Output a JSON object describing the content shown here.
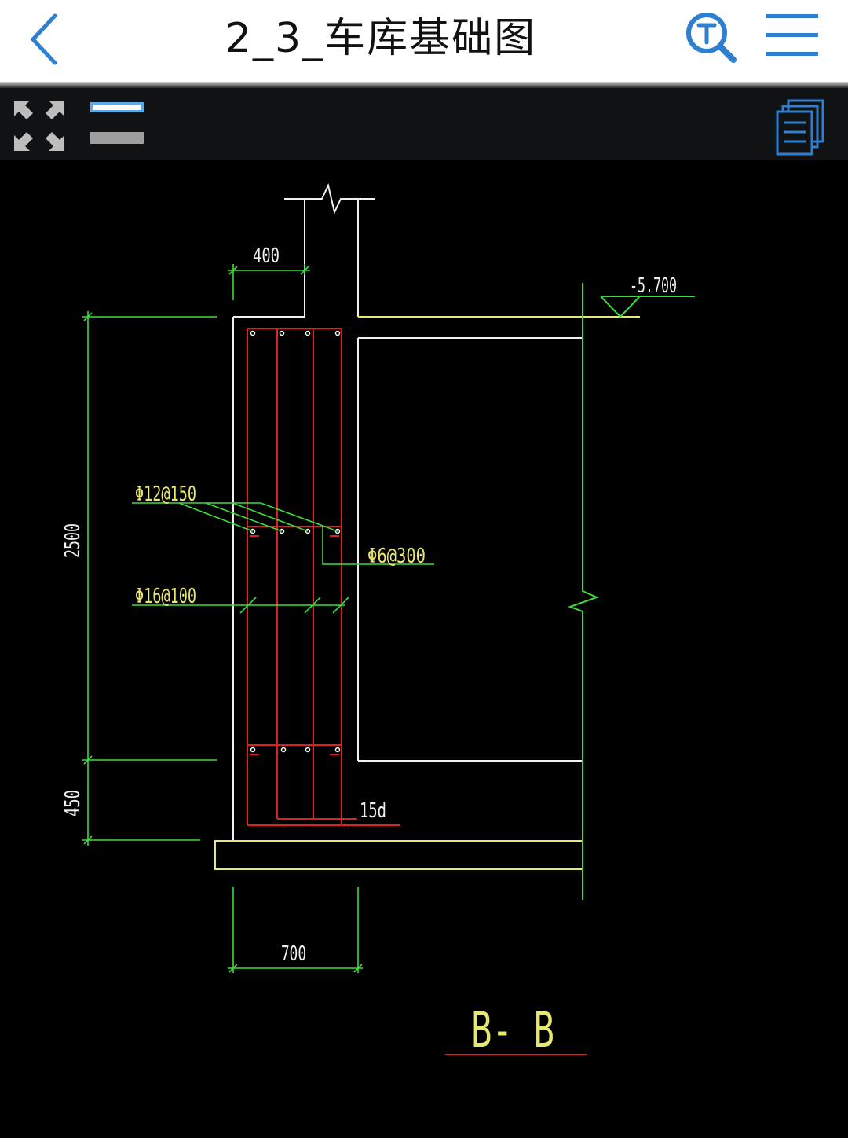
{
  "header": {
    "title": "2_3_车库基础图",
    "back_icon": "chevron-left-icon",
    "search_icon": "text-search-icon",
    "menu_icon": "hamburger-menu-icon"
  },
  "toolbar": {
    "expand_icon": "expand-arrows-icon",
    "layer_icon": "layers-toggle-icon",
    "docs_icon": "documents-stack-icon"
  },
  "colors": {
    "accent": "#2f7fd1",
    "cad_green": "#3ddc3d",
    "cad_yellow": "#e8e870",
    "cad_red": "#e02020",
    "cad_white": "#ffffff"
  },
  "drawing": {
    "dim_top_width": "400",
    "elevation": "-5.700",
    "dim_wall_height": "2500",
    "dim_footing_height": "450",
    "dim_footing_width": "700",
    "rebar_horizontal": "Φ12@150",
    "rebar_tie": "Φ6@300",
    "rebar_vertical": "Φ16@100",
    "anchorage_label": "15d",
    "section_title": "B- B"
  }
}
